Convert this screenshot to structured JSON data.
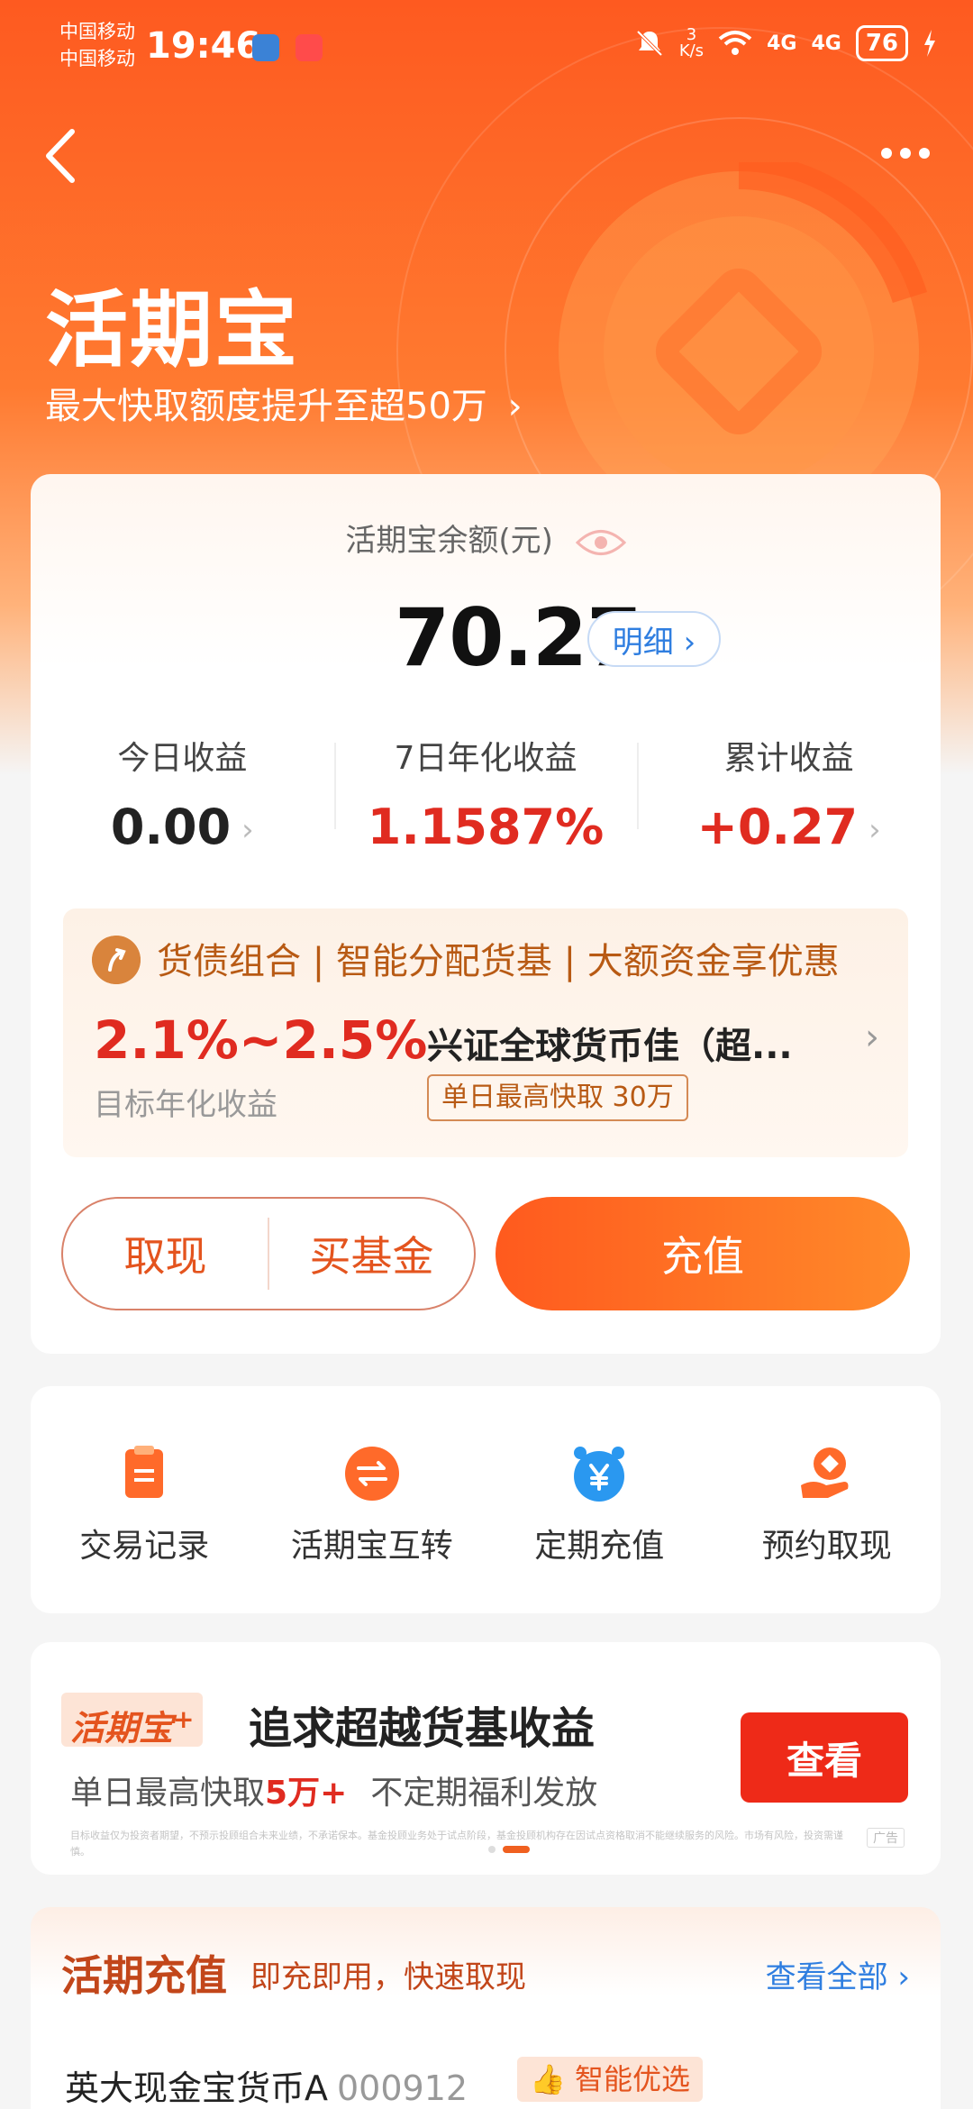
{
  "status_bar": {
    "carrier_1": "中国移动",
    "carrier_2": "中国移动",
    "time": "19:46",
    "net_speed_value": "3",
    "net_speed_unit": "K/s",
    "signal_1": "4G",
    "signal_2": "4G",
    "battery": "76"
  },
  "header": {
    "title": "活期宝",
    "subtitle": "最大快取额度提升至超50万",
    "subtitle_chevron": "›"
  },
  "balance": {
    "label": "活期宝余额(元)",
    "value": "70.27",
    "detail_button": "明细 ›"
  },
  "stats": [
    {
      "label": "今日收益",
      "value": "0.00",
      "color": "#222222"
    },
    {
      "label": "7日年化收益",
      "value": "1.1587%",
      "color": "#e02b20"
    },
    {
      "label": "累计收益",
      "value": "+0.27",
      "color": "#e02b20"
    }
  ],
  "promo": {
    "title": "货债组合 | 智能分配货基 | 大额资金享优惠",
    "rate": "2.1%~2.5%",
    "rate_label": "目标年化收益",
    "fund_name": "兴证全球货币佳（超...",
    "tag": "单日最高快取 30万",
    "chevron": "›"
  },
  "actions": {
    "withdraw": "取现",
    "buy_fund": "买基金",
    "recharge": "充值"
  },
  "functions": [
    {
      "label": "交易记录",
      "icon": "record-icon"
    },
    {
      "label": "活期宝互转",
      "icon": "transfer-icon"
    },
    {
      "label": "定期充值",
      "icon": "alarm-yen-icon"
    },
    {
      "label": "预约取现",
      "icon": "hand-coin-icon"
    }
  ],
  "ad": {
    "badge": "活期宝",
    "badge_plus": "+",
    "title": "追求超越货基收益",
    "sub_prefix": "单日最高快取",
    "sub_highlight": "5万+",
    "sub_suffix": "不定期福利发放",
    "button": "查看",
    "disclaimer": "目标收益仅为投资者期望，不预示投顾组合未来业绩，不承诺保本。基金投顾业务处于试点阶段，基金投顾机构存在因试点资格取消不能继续服务的风险。市场有风险，投资需谨慎。",
    "ad_tag": "广告"
  },
  "list": {
    "title": "活期充值",
    "subtitle": "即充即用，快速取现",
    "more": "查看全部 ›",
    "fund_name": "英大现金宝货币A",
    "fund_code": "000912",
    "fund_tag": "智能优选"
  },
  "colors": {
    "brand_orange": "#ff5a1e",
    "link_blue": "#2f7ee0",
    "gain_red": "#e02b20"
  }
}
